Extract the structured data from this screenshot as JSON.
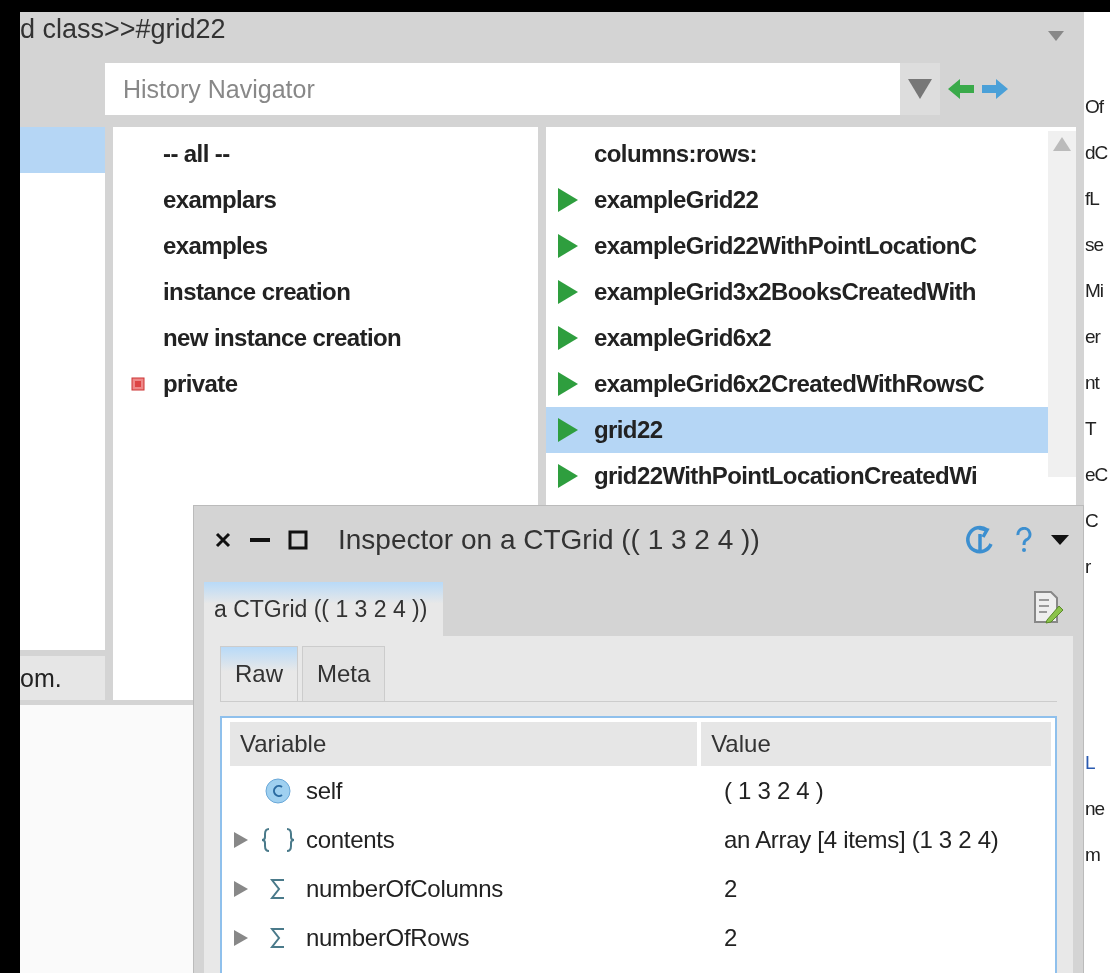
{
  "main_window": {
    "title": "d class>>#grid22",
    "history_field": {
      "placeholder": "History Navigator"
    },
    "class_pane": {
      "rows": [
        {
          "selected": true
        }
      ],
      "button": "om."
    },
    "protocols": [
      {
        "label": "-- all --",
        "flagged": false
      },
      {
        "label": "examplars",
        "flagged": false
      },
      {
        "label": "examples",
        "flagged": false
      },
      {
        "label": "instance creation",
        "flagged": false
      },
      {
        "label": "new instance creation",
        "flagged": false
      },
      {
        "label": "private",
        "flagged": true
      }
    ],
    "methods": [
      {
        "label": "columns:rows:",
        "runnable": false,
        "selected": false
      },
      {
        "label": "exampleGrid22",
        "runnable": true,
        "selected": false
      },
      {
        "label": "exampleGrid22WithPointLocationC",
        "runnable": true,
        "selected": false
      },
      {
        "label": "exampleGrid3x2BooksCreatedWith",
        "runnable": true,
        "selected": false
      },
      {
        "label": "exampleGrid6x2",
        "runnable": true,
        "selected": false
      },
      {
        "label": "exampleGrid6x2CreatedWithRowsC",
        "runnable": true,
        "selected": false
      },
      {
        "label": "grid22",
        "runnable": true,
        "selected": true
      },
      {
        "label": "grid22WithPointLocationCreatedWi",
        "runnable": true,
        "selected": false
      }
    ]
  },
  "inspector": {
    "title": "Inspector on a CTGrid (( 1 3 2 4 ))",
    "tab": {
      "label": "a CTGrid (( 1 3 2 4 ))",
      "selected": true
    },
    "subtabs": [
      {
        "label": "Raw",
        "selected": true
      },
      {
        "label": "Meta",
        "selected": false
      }
    ],
    "columns": [
      "Variable",
      "Value"
    ],
    "rows": [
      {
        "kind": "class",
        "name": "self",
        "value": "( 1 3 2 4 )",
        "expandable": false
      },
      {
        "kind": "array",
        "name": "contents",
        "value": "an Array [4 items] (1 3 2 4)",
        "expandable": true
      },
      {
        "kind": "number",
        "name": "numberOfColumns",
        "value": "2",
        "expandable": true
      },
      {
        "kind": "number",
        "name": "numberOfRows",
        "value": "2",
        "expandable": true
      }
    ]
  },
  "right_window": {
    "fragments_top": [
      "Of",
      "dC",
      "fL",
      "se",
      "Mi",
      "er",
      "nt",
      "T",
      "eC",
      "C",
      "r"
    ],
    "fragments_bottom": [
      "L",
      "ne",
      "m"
    ]
  }
}
